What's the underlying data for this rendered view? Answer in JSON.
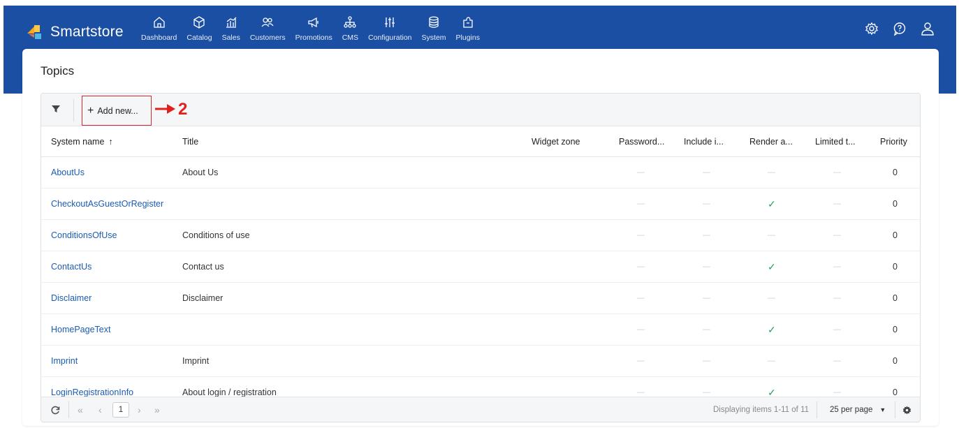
{
  "brand": {
    "name": "Smartstore"
  },
  "nav": [
    {
      "label": "Dashboard",
      "icon": "home-icon"
    },
    {
      "label": "Catalog",
      "icon": "cube-icon"
    },
    {
      "label": "Sales",
      "icon": "chart-bar-icon"
    },
    {
      "label": "Customers",
      "icon": "people-icon"
    },
    {
      "label": "Promotions",
      "icon": "megaphone-icon"
    },
    {
      "label": "CMS",
      "icon": "sitemap-icon"
    },
    {
      "label": "Configuration",
      "icon": "sliders-icon"
    },
    {
      "label": "System",
      "icon": "database-icon"
    },
    {
      "label": "Plugins",
      "icon": "puzzle-icon"
    }
  ],
  "page": {
    "title": "Topics"
  },
  "toolbar": {
    "add_label": "Add new...",
    "annotation": "2"
  },
  "columns": {
    "system_name": "System name",
    "title": "Title",
    "widget_zone": "Widget zone",
    "password": "Password...",
    "include": "Include i...",
    "render": "Render a...",
    "limited": "Limited t...",
    "priority": "Priority"
  },
  "rows": [
    {
      "system_name": "AboutUs",
      "title": "About Us",
      "render": false,
      "priority": "0"
    },
    {
      "system_name": "CheckoutAsGuestOrRegister",
      "title": "",
      "render": true,
      "priority": "0"
    },
    {
      "system_name": "ConditionsOfUse",
      "title": "Conditions of use",
      "render": false,
      "priority": "0"
    },
    {
      "system_name": "ContactUs",
      "title": "Contact us",
      "render": true,
      "priority": "0"
    },
    {
      "system_name": "Disclaimer",
      "title": "Disclaimer",
      "render": false,
      "priority": "0"
    },
    {
      "system_name": "HomePageText",
      "title": "",
      "render": true,
      "priority": "0"
    },
    {
      "system_name": "Imprint",
      "title": "Imprint",
      "render": false,
      "priority": "0"
    },
    {
      "system_name": "LoginRegistrationInfo",
      "title": "About login / registration",
      "render": true,
      "priority": "0"
    }
  ],
  "pager": {
    "current_page": "1",
    "summary": "Displaying items 1-11 of 11",
    "per_page": "25 per page"
  },
  "colors": {
    "header": "#1b4fa3",
    "link": "#1b5cb3",
    "check": "#2e9e5b",
    "annotation": "#e0201c"
  }
}
